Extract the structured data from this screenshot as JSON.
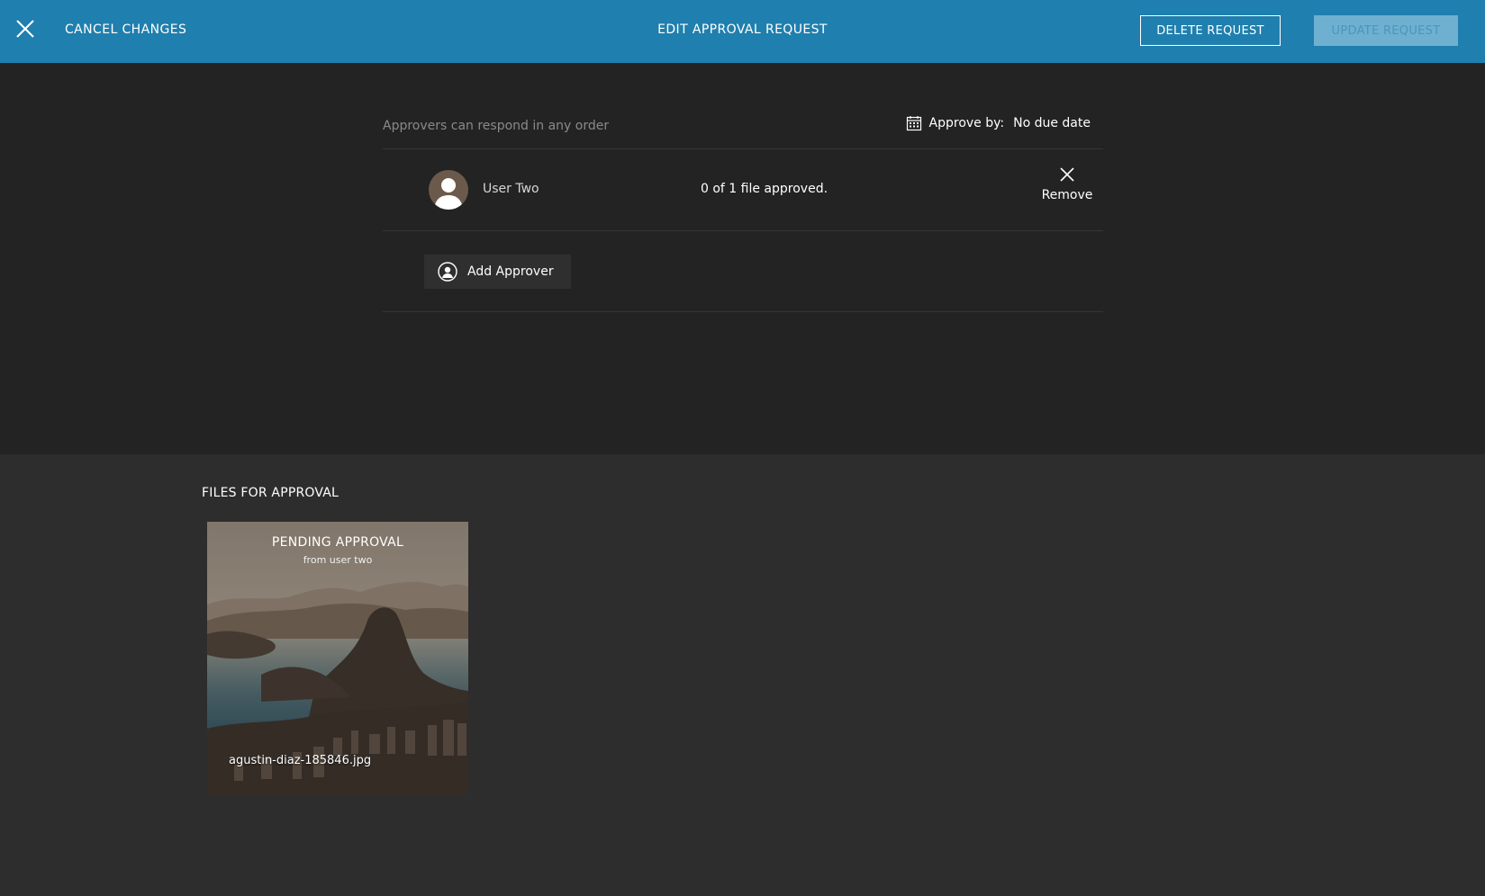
{
  "header": {
    "cancel_label": "CANCEL CHANGES",
    "title": "EDIT APPROVAL REQUEST",
    "delete_label": "DELETE REQUEST",
    "update_label": "UPDATE REQUEST",
    "close_icon": "close-icon",
    "colors": {
      "bar": "#1f7fae",
      "update_disabled_bg": "#6fb0d0"
    }
  },
  "approvers": {
    "order_note": "Approvers can respond in any order",
    "approve_by_label": "Approve by:",
    "due_date": "No due date",
    "calendar_icon": "calendar-icon",
    "list": [
      {
        "name": "User Two",
        "status": "0 of 1 file approved.",
        "remove_label": "Remove"
      }
    ],
    "add_label": "Add Approver"
  },
  "files": {
    "title": "FILES FOR APPROVAL",
    "items": [
      {
        "status": "PENDING APPROVAL",
        "from": "from user two",
        "filename": "agustin-diaz-185846.jpg"
      }
    ]
  }
}
